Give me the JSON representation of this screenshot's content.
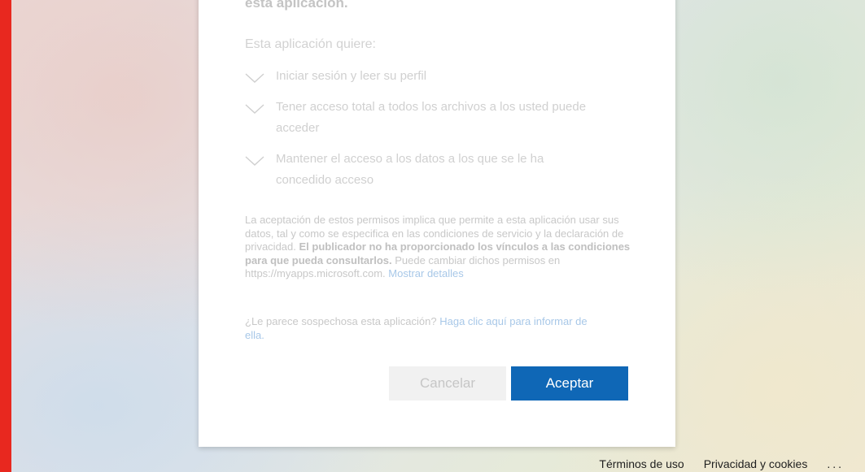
{
  "dialog": {
    "heading": "esta aplicación.",
    "subheading": "Esta aplicación quiere:",
    "permissions": [
      {
        "label": "Iniciar sesión y leer su perfil",
        "icon": "chevron-down-icon"
      },
      {
        "label": "Tener acceso total a todos los archivos a los usted puede acceder",
        "icon": "chevron-down-icon"
      },
      {
        "label": "Mantener el acceso a los datos a los que se le ha concedido acceso",
        "icon": "chevron-down-icon"
      }
    ],
    "consent": {
      "text1": "La aceptación de estos permisos implica que permite a esta aplicación usar sus datos, tal y como se especifica en las condiciones de servicio y la declaración de privacidad. ",
      "bold": "El publicador no ha proporcionado los vínculos a las condiciones para que pueda consultarlos.",
      "text2": " Puede cambiar dichos permisos en https://myapps.microsoft.com. ",
      "link": "Mostrar detalles"
    },
    "suspicious": {
      "text": "¿Le parece sospechosa esta aplicación? ",
      "link": "Haga clic aquí para informar de ella."
    },
    "buttons": {
      "cancel": "Cancelar",
      "accept": "Aceptar"
    }
  },
  "footer": {
    "terms": "Términos de uso",
    "privacy": "Privacidad y cookies",
    "more": "..."
  },
  "colors": {
    "accent": "#0f67b6",
    "edge": "#e8281f"
  }
}
